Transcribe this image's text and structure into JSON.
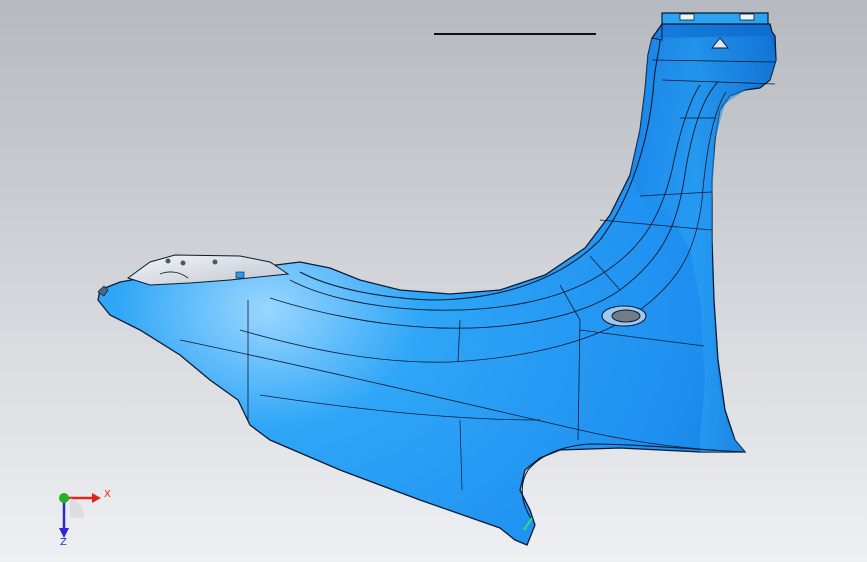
{
  "viewport": {
    "background": {
      "top": "#b6b9bf",
      "bottom": "#eef0f3"
    },
    "part": {
      "name": "fender",
      "fill": "#2a9bf2",
      "fill_highlight": "#8fd0ff",
      "fill_shadow": "#0f6fd0",
      "edge_color": "#0a1c33"
    }
  },
  "triad": {
    "x_label": "X",
    "z_label": "Z",
    "x_color": "#e0261b",
    "y_color": "#24b024",
    "z_color": "#2a2ad0"
  }
}
